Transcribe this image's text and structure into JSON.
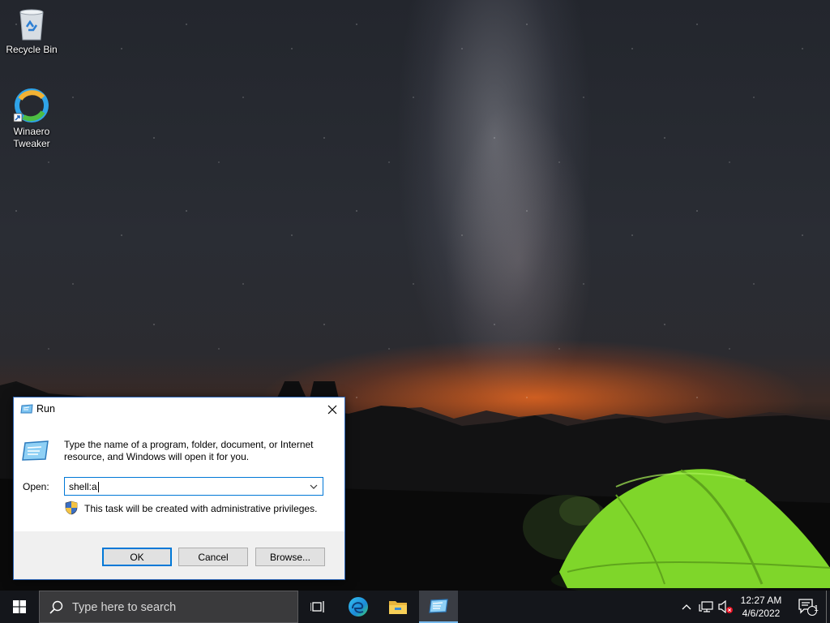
{
  "desktop": {
    "icons": [
      {
        "label": "Recycle Bin",
        "icon": "recycle-bin-icon"
      },
      {
        "label": "Winaero\nTweaker",
        "label_line1": "Winaero",
        "label_line2": "Tweaker",
        "icon": "winaero-tweaker-icon"
      }
    ]
  },
  "run_dialog": {
    "title": "Run",
    "description": "Type the name of a program, folder, document, or Internet resource, and Windows will open it for you.",
    "open_label": "Open:",
    "input_value": "shell:a",
    "admin_note": "This task will be created with administrative privileges.",
    "buttons": {
      "ok": "OK",
      "cancel": "Cancel",
      "browse": "Browse..."
    }
  },
  "taskbar": {
    "search_placeholder": "Type here to search",
    "pinned": [
      "start-icon",
      "task-view-icon",
      "edge-icon",
      "file-explorer-icon",
      "run-icon"
    ],
    "clock": {
      "time": "12:27 AM",
      "date": "4/6/2022"
    },
    "notification_count": "1"
  },
  "colors": {
    "accent": "#0078d7",
    "taskbar": "#14161b",
    "tent": "#7fd62a"
  }
}
